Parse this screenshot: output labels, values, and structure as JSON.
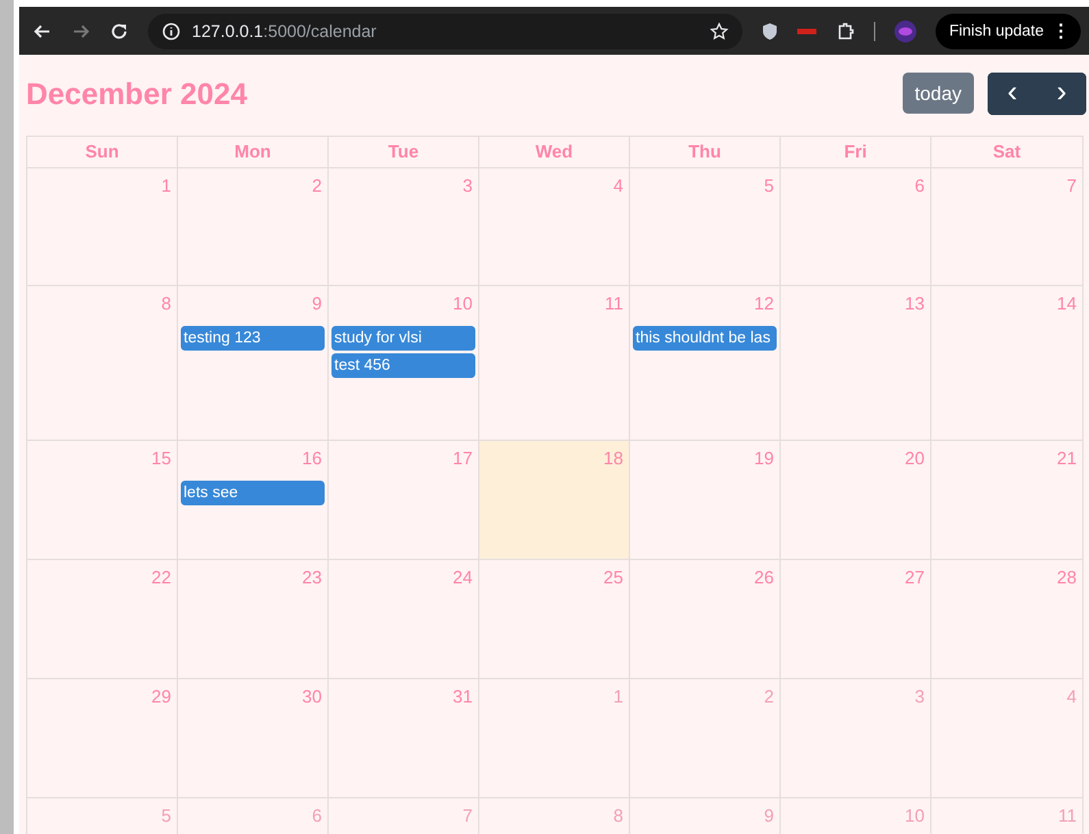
{
  "browser": {
    "url_host": "127.0.0.1",
    "url_path": ":5000/calendar",
    "update_button": "Finish update",
    "menu_glyph": "⋮"
  },
  "calendar": {
    "title": "December 2024",
    "today_button": "today",
    "prev_glyph": "‹",
    "next_glyph": "›",
    "weekdays": [
      "Sun",
      "Mon",
      "Tue",
      "Wed",
      "Thu",
      "Fri",
      "Sat"
    ],
    "weeks": [
      {
        "days": [
          {
            "number": "1",
            "other_month": false,
            "today": false
          },
          {
            "number": "2",
            "other_month": false,
            "today": false
          },
          {
            "number": "3",
            "other_month": false,
            "today": false
          },
          {
            "number": "4",
            "other_month": false,
            "today": false
          },
          {
            "number": "5",
            "other_month": false,
            "today": false
          },
          {
            "number": "6",
            "other_month": false,
            "today": false
          },
          {
            "number": "7",
            "other_month": false,
            "today": false
          }
        ]
      },
      {
        "days": [
          {
            "number": "8",
            "other_month": false,
            "today": false
          },
          {
            "number": "9",
            "other_month": false,
            "today": false,
            "events": [
              "testing 123"
            ]
          },
          {
            "number": "10",
            "other_month": false,
            "today": false,
            "events": [
              "study for vlsi",
              "test 456"
            ]
          },
          {
            "number": "11",
            "other_month": false,
            "today": false
          },
          {
            "number": "12",
            "other_month": false,
            "today": false,
            "events": [
              "this shouldnt be las"
            ]
          },
          {
            "number": "13",
            "other_month": false,
            "today": false
          },
          {
            "number": "14",
            "other_month": false,
            "today": false
          }
        ]
      },
      {
        "days": [
          {
            "number": "15",
            "other_month": false,
            "today": false
          },
          {
            "number": "16",
            "other_month": false,
            "today": false,
            "events": [
              "lets see"
            ]
          },
          {
            "number": "17",
            "other_month": false,
            "today": false
          },
          {
            "number": "18",
            "other_month": false,
            "today": true
          },
          {
            "number": "19",
            "other_month": false,
            "today": false
          },
          {
            "number": "20",
            "other_month": false,
            "today": false
          },
          {
            "number": "21",
            "other_month": false,
            "today": false
          }
        ]
      },
      {
        "days": [
          {
            "number": "22",
            "other_month": false,
            "today": false
          },
          {
            "number": "23",
            "other_month": false,
            "today": false
          },
          {
            "number": "24",
            "other_month": false,
            "today": false
          },
          {
            "number": "25",
            "other_month": false,
            "today": false
          },
          {
            "number": "26",
            "other_month": false,
            "today": false
          },
          {
            "number": "27",
            "other_month": false,
            "today": false
          },
          {
            "number": "28",
            "other_month": false,
            "today": false
          }
        ]
      },
      {
        "days": [
          {
            "number": "29",
            "other_month": false,
            "today": false
          },
          {
            "number": "30",
            "other_month": false,
            "today": false
          },
          {
            "number": "31",
            "other_month": false,
            "today": false
          },
          {
            "number": "1",
            "other_month": true,
            "today": false
          },
          {
            "number": "2",
            "other_month": true,
            "today": false
          },
          {
            "number": "3",
            "other_month": true,
            "today": false
          },
          {
            "number": "4",
            "other_month": true,
            "today": false
          }
        ]
      },
      {
        "days": [
          {
            "number": "5",
            "other_month": true,
            "today": false
          },
          {
            "number": "6",
            "other_month": true,
            "today": false
          },
          {
            "number": "7",
            "other_month": true,
            "today": false
          },
          {
            "number": "8",
            "other_month": true,
            "today": false
          },
          {
            "number": "9",
            "other_month": true,
            "today": false
          },
          {
            "number": "10",
            "other_month": true,
            "today": false
          },
          {
            "number": "11",
            "other_month": true,
            "today": false
          }
        ]
      }
    ]
  }
}
